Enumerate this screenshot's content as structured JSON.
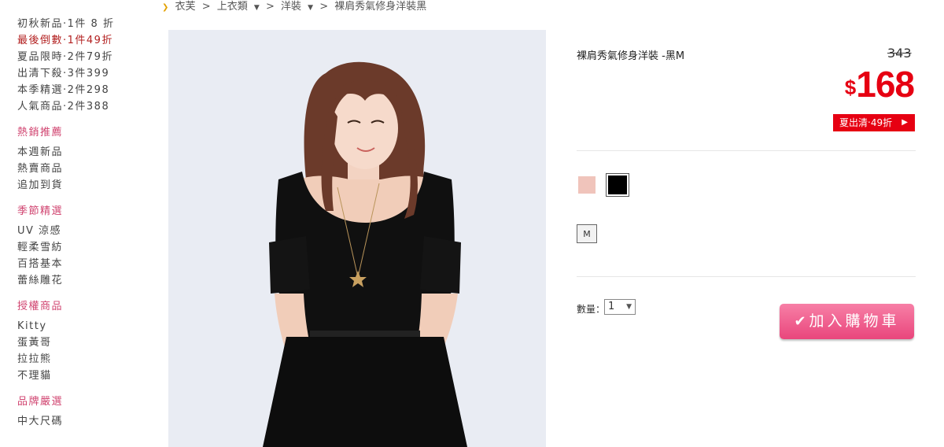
{
  "sidebar": {
    "promo_items": [
      {
        "label": "初秋新品‧1件 8 折",
        "highlight": false
      },
      {
        "label": "最後倒數‧1件49折",
        "highlight": true
      },
      {
        "label": "夏品限時‧2件79折",
        "highlight": false
      },
      {
        "label": "出清下殺‧3件399",
        "highlight": false
      },
      {
        "label": "本季精選‧2件298",
        "highlight": false
      },
      {
        "label": "人氣商品‧2件388",
        "highlight": false
      }
    ],
    "sections": [
      {
        "heading": "熱銷推薦",
        "items": [
          "本週新品",
          "熱賣商品",
          "追加到貨"
        ]
      },
      {
        "heading": "季節精選",
        "items": [
          "UV 涼感",
          "輕柔雪紡",
          "百搭基本",
          "蕾絲雕花"
        ]
      },
      {
        "heading": "授權商品",
        "items": [
          "Kitty",
          "蛋黃哥",
          "拉拉熊",
          "不理貓"
        ]
      },
      {
        "heading": "品牌嚴選",
        "items": [
          "中大尺碼"
        ]
      }
    ],
    "accent_color": "#d0436f",
    "highlight_color": "#b21f1f"
  },
  "breadcrumb": {
    "home": "衣芙",
    "level1": "上衣類",
    "level2": "洋裝",
    "current": "裸肩秀氣修身洋裝黑",
    "separator": ">"
  },
  "product": {
    "title": "裸肩秀氣修身洋裝 -黑M",
    "original_price": "343",
    "currency": "$",
    "sale_price": "168",
    "promo_badge": "夏出清‧49折",
    "colors": [
      {
        "name": "pink",
        "hex": "#f0c4bb"
      },
      {
        "name": "black",
        "hex": "#000000",
        "selected": true
      }
    ],
    "sizes": [
      "M"
    ],
    "quantity_label": "數量：",
    "quantity_value": "1",
    "add_to_cart": "加入購物車",
    "price_color": "#e60012",
    "button_color": "#ef5f8f"
  },
  "icons": {
    "breadcrumb_arrow": "chevron-right-icon",
    "dropdown": "caret-down-icon",
    "cart_check": "check-icon",
    "badge_arrow": "triangle-right-icon"
  }
}
